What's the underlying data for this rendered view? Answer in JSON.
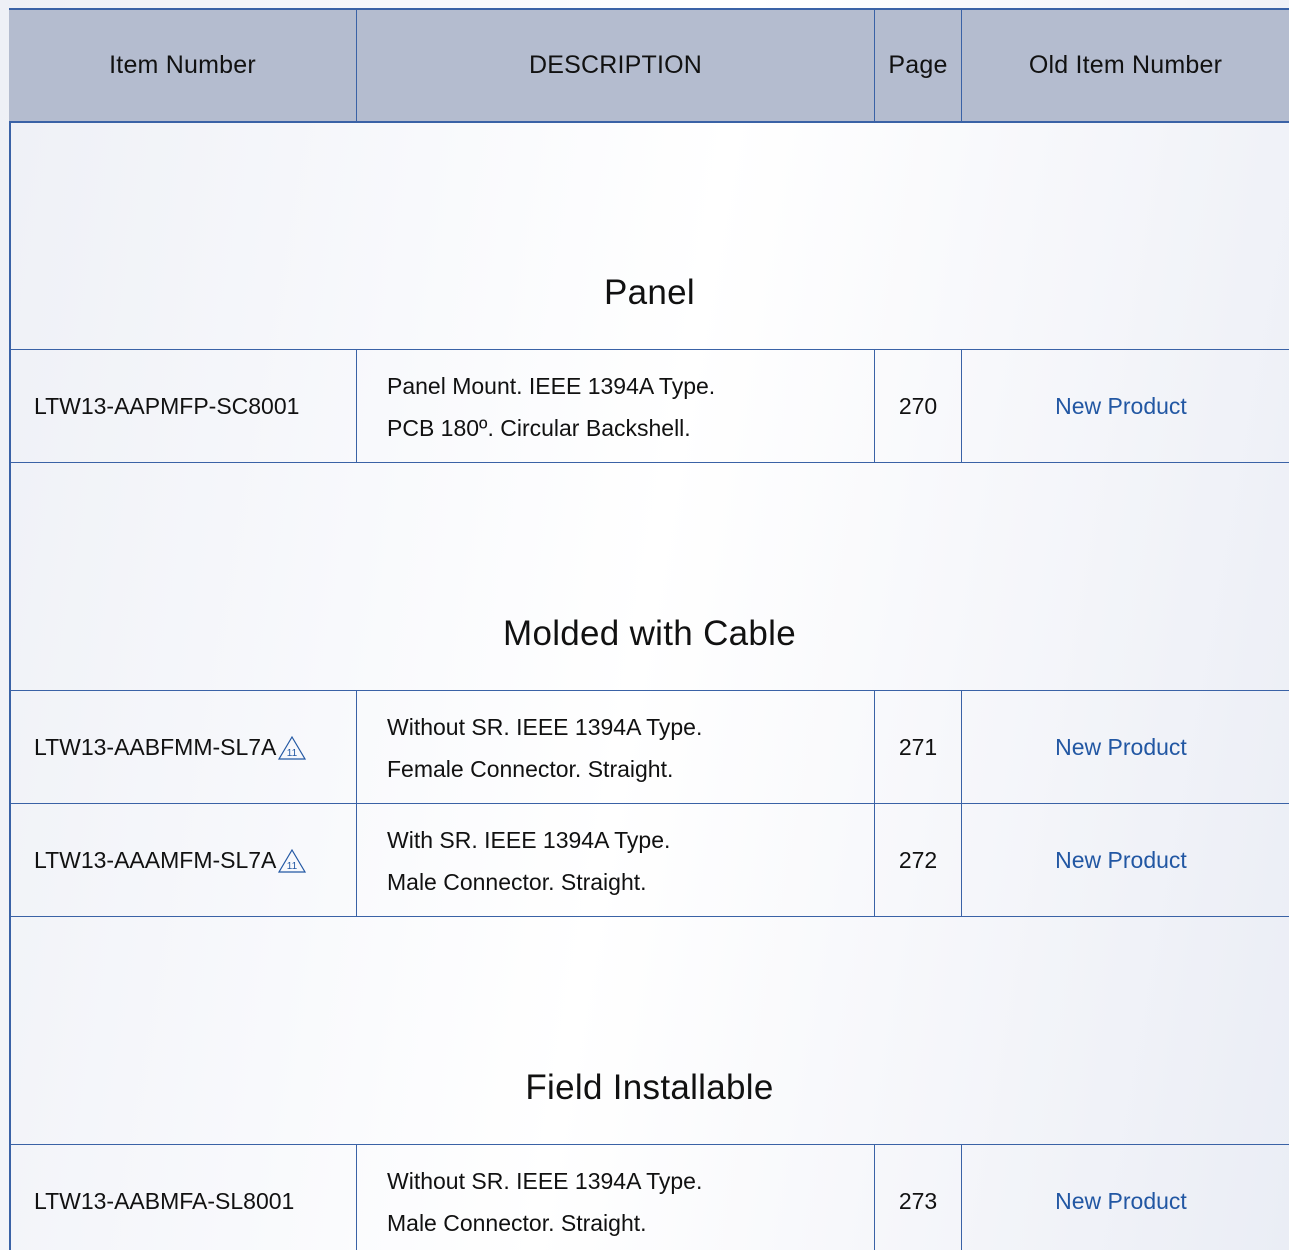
{
  "header": {
    "item_number": "Item Number",
    "description": "DESCRIPTION",
    "page": "Page",
    "old_item_number": "Old Item Number"
  },
  "sections": [
    {
      "title": "Panel",
      "rows": [
        {
          "item": "LTW13-AAPMFP-SC8001",
          "note_icon": false,
          "desc_line1": "Panel Mount. IEEE 1394A Type.",
          "desc_line2": "PCB 180º. Circular Backshell.",
          "page": "270",
          "old": "New Product"
        }
      ]
    },
    {
      "title": "Molded with Cable",
      "rows": [
        {
          "item": "LTW13-AABFMM-SL7A",
          "note_icon": true,
          "note_number": "11",
          "desc_line1": "Without SR. IEEE 1394A Type.",
          "desc_line2": "Female Connector. Straight.",
          "page": "271",
          "old": "New Product"
        },
        {
          "item": "LTW13-AAAMFM-SL7A",
          "note_icon": true,
          "note_number": "11",
          "desc_line1": "With SR. IEEE 1394A Type.",
          "desc_line2": "Male Connector. Straight.",
          "page": "272",
          "old": "New Product"
        }
      ]
    },
    {
      "title": "Field Installable",
      "rows": [
        {
          "item": "LTW13-AABMFA-SL8001",
          "note_icon": false,
          "desc_line1": "Without SR. IEEE 1394A Type.",
          "desc_line2": "Male Connector. Straight.",
          "page": "273",
          "old": "New Product"
        }
      ]
    }
  ],
  "colors": {
    "border": "#3a62a6",
    "header_bg": "#b4bccf",
    "link": "#2257a3",
    "text": "#111111"
  }
}
